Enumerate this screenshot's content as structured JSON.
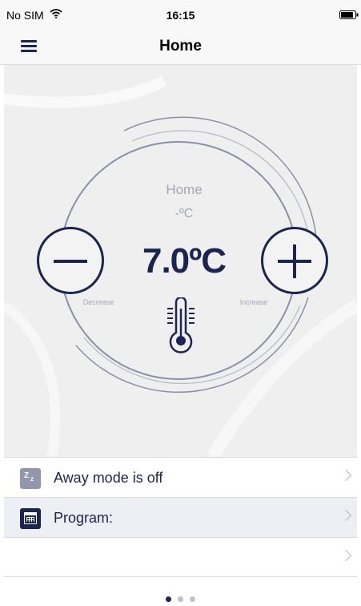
{
  "status_bar": {
    "carrier": "No SIM",
    "time": "16:15"
  },
  "nav": {
    "title": "Home",
    "menu_icon": "hamburger-menu-icon"
  },
  "thermostat": {
    "room_name": "Home",
    "current_temperature": "-ºC",
    "setpoint": "7.0ºC",
    "decrease_label": "Decrease",
    "increase_label": "Increase",
    "icon": "thermometer-icon"
  },
  "list": {
    "items": [
      {
        "label": "Away mode is off",
        "icon": "sleep-zz-icon"
      },
      {
        "label": "Program:",
        "icon": "calendar-icon"
      },
      {
        "label": "",
        "icon": ""
      }
    ]
  },
  "pager": {
    "page_count": 3,
    "active_page": 1
  },
  "colors": {
    "primary": "#1c2451",
    "muted_text": "#a3a6b3",
    "panel_background": "#efefef",
    "away_icon": "#9297ad",
    "highlight_row": "#eeeff5"
  }
}
